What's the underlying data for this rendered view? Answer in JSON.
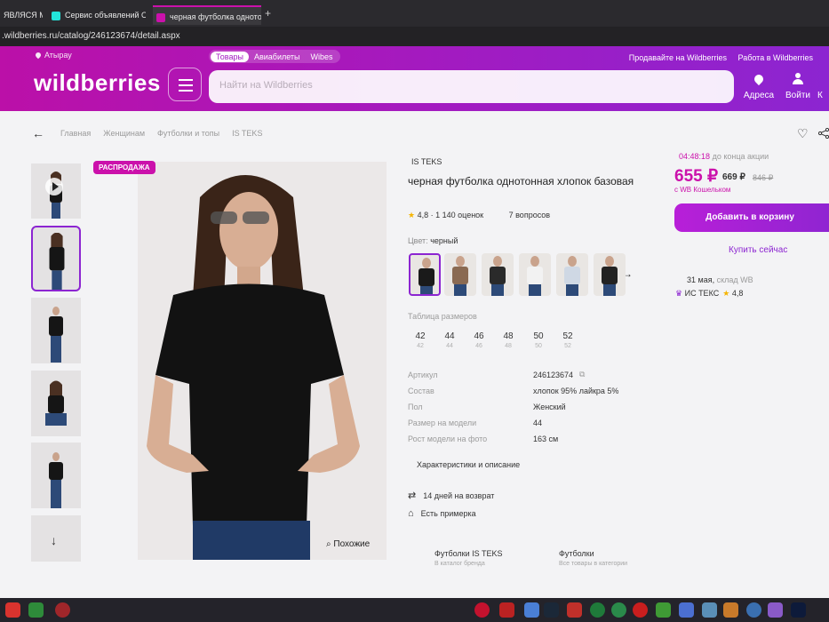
{
  "browser": {
    "tabs": [
      {
        "label": "ЯВЛЯСЯ МЕ"
      },
      {
        "label": "Сервис объявлений OLX"
      },
      {
        "label": "черная футболка одното"
      }
    ],
    "new_tab": "+",
    "url": ".wildberries.ru/catalog/246123674/detail.aspx"
  },
  "header": {
    "location": "Атырау",
    "segments": [
      "Товары",
      "Авиабилеты",
      "Wibes"
    ],
    "top_links": [
      "Продавайте на Wildberries",
      "Работа в Wildberries"
    ],
    "logo": "wildberries",
    "search_placeholder": "Найти на Wildberries",
    "icons": [
      {
        "label": "Адреса",
        "icon": "location-pin-icon"
      },
      {
        "label": "Войти",
        "icon": "user-icon"
      }
    ],
    "cut_label": "К"
  },
  "breadcrumbs": [
    "Главная",
    "Женщинам",
    "Футболки и топы",
    "IS TEKS"
  ],
  "product": {
    "sale_badge": "РАСПРОДАЖА",
    "brand": "IS TEKS",
    "title": "черная футболка однотонная хлопок базовая",
    "rating": "4,8",
    "reviews": "1 140 оценок",
    "questions": "7 вопросов",
    "color_label": "Цвет:",
    "color_value": "черный",
    "color_swatches": [
      "#1a1a1a",
      "#8a6a52",
      "#2a2a2a",
      "#f2f2f2",
      "#cfd8e4",
      "#222222"
    ],
    "size_table_label": "Таблица размеров",
    "sizes": [
      {
        "eu": "42",
        "ru": "42"
      },
      {
        "eu": "44",
        "ru": "44"
      },
      {
        "eu": "46",
        "ru": "46"
      },
      {
        "eu": "48",
        "ru": "48"
      },
      {
        "eu": "50",
        "ru": "50"
      },
      {
        "eu": "52",
        "ru": "52"
      }
    ],
    "specs": [
      {
        "key": "Артикул",
        "value": "246123674"
      },
      {
        "key": "Состав",
        "value": "хлопок 95% лайкра 5%"
      },
      {
        "key": "Пол",
        "value": "Женский"
      },
      {
        "key": "Размер на модели",
        "value": "44"
      },
      {
        "key": "Рост модели на фото",
        "value": "163 см"
      }
    ],
    "chars_link": "Характеристики и описание",
    "features": [
      "14 дней на возврат",
      "Есть примерка"
    ],
    "similar": "Похожие",
    "brand_cards": [
      {
        "title": "Футболки IS TEKS",
        "sub": "В каталог бренда"
      },
      {
        "title": "Футболки",
        "sub": "Все товары в категории"
      }
    ]
  },
  "buy": {
    "timer": "04:48:18",
    "timer_label": "до конца акции",
    "price": "655 ₽",
    "price_wallet": "669 ₽",
    "price_old": "846 ₽",
    "wallet_note": "с WB Кошельком",
    "add_to_cart": "Добавить в корзину",
    "buy_now": "Купить сейчас",
    "delivery_date": "31 мая,",
    "delivery_place": "склад WB",
    "seller": "ИС ТЕКС",
    "seller_rating": "4,8"
  },
  "colors": {
    "brand_magenta": "#cb11ab",
    "brand_purple": "#8c25d1"
  }
}
